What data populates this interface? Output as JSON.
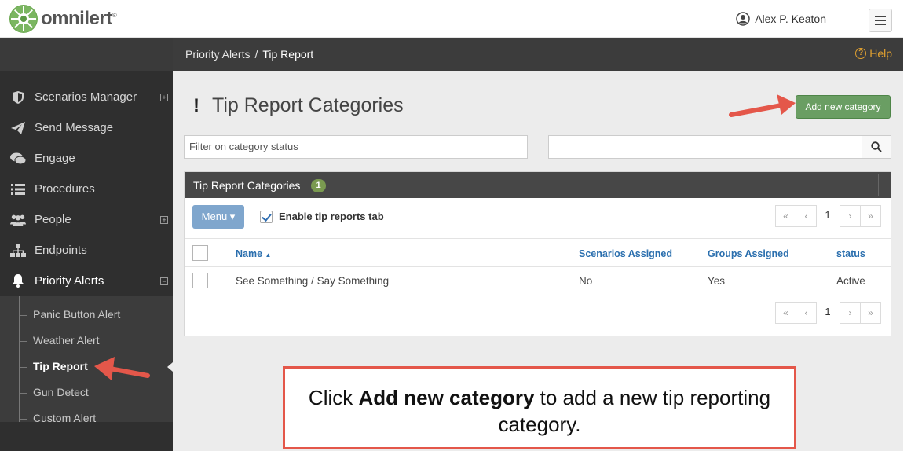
{
  "brand": {
    "name": "omnilert",
    "reg": "®"
  },
  "user": {
    "name": "Alex P. Keaton"
  },
  "breadcrumb": {
    "parent": "Priority Alerts",
    "separator": "/",
    "current": "Tip Report"
  },
  "help_label": "Help",
  "sidebar": {
    "items": [
      {
        "label": "Scenarios Manager",
        "icon": "shield-icon",
        "expandable": true
      },
      {
        "label": "Send Message",
        "icon": "paper-plane-icon",
        "expandable": false
      },
      {
        "label": "Engage",
        "icon": "chat-bubbles-icon",
        "expandable": false
      },
      {
        "label": "Procedures",
        "icon": "list-icon",
        "expandable": false
      },
      {
        "label": "People",
        "icon": "users-icon",
        "expandable": true
      },
      {
        "label": "Endpoints",
        "icon": "sitemap-icon",
        "expandable": false
      },
      {
        "label": "Priority Alerts",
        "icon": "bell-icon",
        "expandable": true,
        "expanded": true
      }
    ],
    "sub_items": [
      "Panic Button Alert",
      "Weather Alert",
      "Tip Report",
      "Gun Detect",
      "Custom Alert"
    ],
    "current_sub": "Tip Report"
  },
  "page": {
    "title_icon": "!",
    "title": "Tip Report Categories",
    "add_button": "Add new category",
    "filter_placeholder": "Filter on category status"
  },
  "panel": {
    "title": "Tip Report Categories",
    "count": "1",
    "menu_button": "Menu",
    "enable_label": "Enable tip reports tab",
    "enable_checked": true,
    "page_number": "1",
    "columns": [
      "Name",
      "Scenarios Assigned",
      "Groups Assigned",
      "status"
    ],
    "sort_indicator": "▲",
    "rows": [
      {
        "name": "See Something / Say Something",
        "scenarios": "No",
        "groups": "Yes",
        "status": "Active"
      }
    ]
  },
  "callout": {
    "prefix": "Click ",
    "bold": "Add new category",
    "suffix": " to add a new tip reporting category."
  },
  "colors": {
    "accent_green": "#6a9e63",
    "link_blue": "#2b6fae",
    "annotation_red": "#e4574a",
    "help_orange": "#e0a030"
  }
}
